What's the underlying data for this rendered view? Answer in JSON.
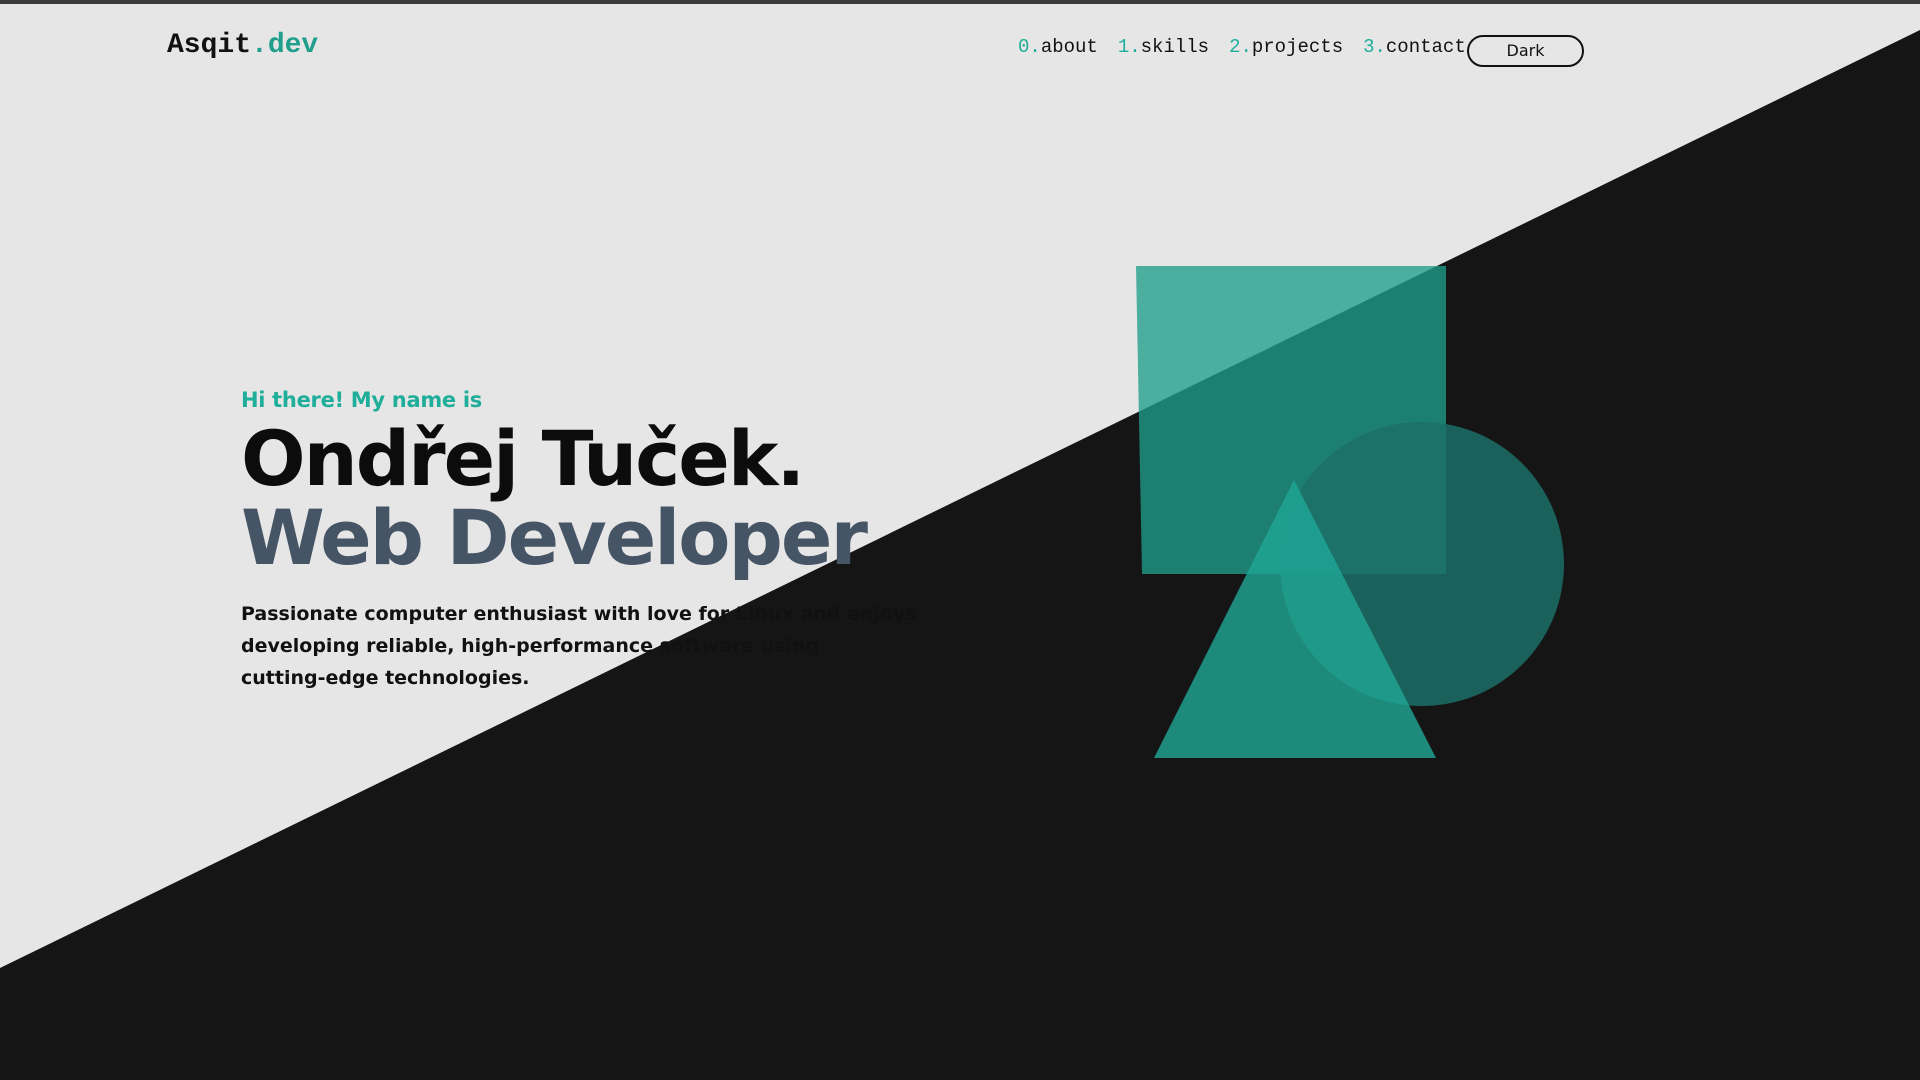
{
  "logo": {
    "main": "Asqit",
    "accent": ".dev"
  },
  "nav": {
    "items": [
      {
        "num": "0.",
        "label": "about"
      },
      {
        "num": "1.",
        "label": "skills"
      },
      {
        "num": "2.",
        "label": "projects"
      },
      {
        "num": "3.",
        "label": "contact"
      }
    ],
    "theme_button": "Dark"
  },
  "hero": {
    "greeting": "Hi there! My name is",
    "name": "Ondřej Tuček.",
    "role": "Web Developer",
    "bio_lines": [
      "Passionate computer enthusiast with love for Linux and enjoys",
      "developing reliable, high-performance software using",
      "cutting-edge technologies."
    ]
  },
  "colors": {
    "background_light": "#e6e6e6",
    "background_dark": "#151515",
    "accent": "#1fae9a",
    "role_text": "#465566",
    "shape_square": "#1f9e8a",
    "shape_circle": "#1c6f67",
    "shape_triangle": "#1fa896"
  },
  "icons": {
    "decorative_shapes": [
      "square-shape",
      "circle-shape",
      "triangle-shape"
    ]
  }
}
